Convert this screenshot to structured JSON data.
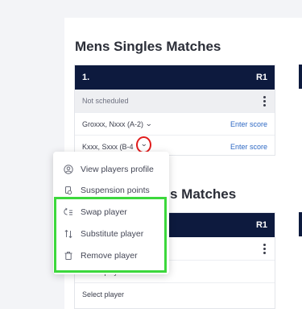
{
  "sections": [
    {
      "title": "Mens Singles Matches"
    },
    {
      "title": "s Matches"
    }
  ],
  "card1": {
    "number": "1.",
    "round": "R1",
    "status": "Not scheduled",
    "players": [
      {
        "name": "Groxxx, Nxxx (A-2)",
        "action": "Enter score"
      },
      {
        "name": "Kxxx, Sxxx (B-4",
        "action": "Enter score"
      }
    ]
  },
  "card2": {
    "round": "R1",
    "rows": [
      "Select player",
      "Select player"
    ]
  },
  "menu": {
    "items": [
      {
        "label": "View players profile",
        "icon": "user-circle-icon"
      },
      {
        "label": "Suspension points",
        "icon": "suspension-icon"
      },
      {
        "label": "Swap player",
        "icon": "swap-icon"
      },
      {
        "label": "Substitute player",
        "icon": "substitute-arrows-icon"
      },
      {
        "label": "Remove player",
        "icon": "trash-icon"
      }
    ]
  },
  "colors": {
    "header_bg": "#0d1a3e",
    "link": "#2d68c4",
    "highlight_green": "#3cd83c",
    "highlight_red": "#e11b1b"
  }
}
